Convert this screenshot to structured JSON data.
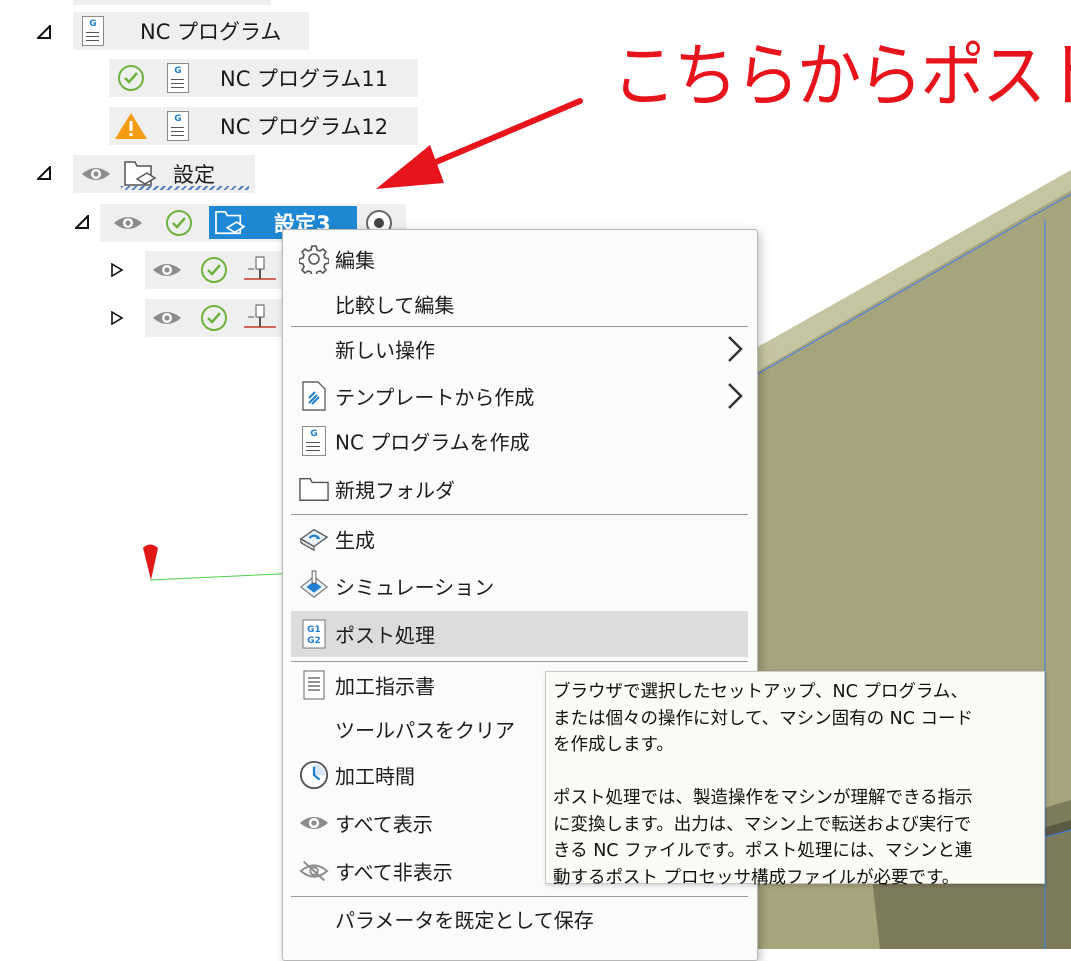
{
  "annotation": {
    "text": "こちらからポスト",
    "color": "#e8141c"
  },
  "browser": {
    "nc_program_root": "NC プログラム",
    "nc_program_11": "NC プログラム11",
    "nc_program_12": "NC プログラム12",
    "setups_folder": "設定",
    "setup_selected": "設定3"
  },
  "menu": {
    "items": [
      {
        "label": "編集",
        "icon": "gear-icon"
      },
      {
        "label": "比較して編集",
        "icon": ""
      },
      {
        "label": "新しい操作",
        "icon": "",
        "submenu": true
      },
      {
        "label": "テンプレートから作成",
        "icon": "template-icon",
        "submenu": true
      },
      {
        "label": "NC プログラムを作成",
        "icon": "nc-program-icon"
      },
      {
        "label": "新規フォルダ",
        "icon": "folder-icon"
      },
      {
        "label": "生成",
        "icon": "generate-icon"
      },
      {
        "label": "シミュレーション",
        "icon": "simulation-icon"
      },
      {
        "label": "ポスト処理",
        "icon": "post-process-icon",
        "highlighted": true
      },
      {
        "label": "加工指示書",
        "icon": "setup-sheet-icon"
      },
      {
        "label": "ツールパスをクリア",
        "icon": ""
      },
      {
        "label": "加工時間",
        "icon": "clock-icon"
      },
      {
        "label": "すべて表示",
        "icon": "eye-icon"
      },
      {
        "label": "すべて非表示",
        "icon": "eye-hidden-icon"
      },
      {
        "label": "パラメータを既定として保存",
        "icon": ""
      }
    ]
  },
  "tooltip": {
    "text": "ブラウザで選択したセットアップ、NC プログラム、\nまたは個々の操作に対して、マシン固有の NC コード\nを作成します。\n\nポスト処理では、製造操作をマシンが理解できる指示\nに変換します。出力は、マシン上で転送および実行で\nきる NC ファイルです。ポスト処理には、マシンと連\n動するポスト プロセッサ構成ファイルが必要です。"
  },
  "colors": {
    "accent": "#1e88d4",
    "status_ok": "#6db33f",
    "status_warn": "#f39c12",
    "highlight_bg": "#dcdcdc"
  }
}
